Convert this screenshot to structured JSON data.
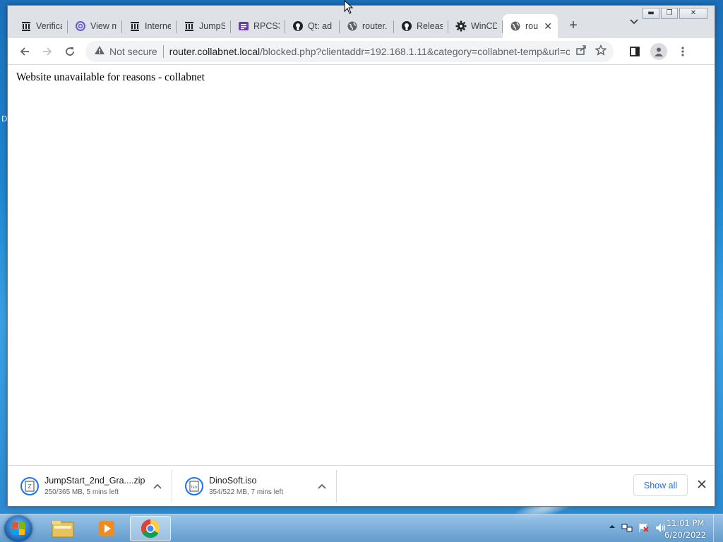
{
  "browser": {
    "tabs": [
      {
        "label": "Verifica",
        "icon": "bank-icon"
      },
      {
        "label": "View m",
        "icon": "at-icon"
      },
      {
        "label": "Interne",
        "icon": "bank-icon"
      },
      {
        "label": "JumpS",
        "icon": "bank-icon"
      },
      {
        "label": "RPCS3",
        "icon": "form-icon"
      },
      {
        "label": "Qt: ad",
        "icon": "github-icon"
      },
      {
        "label": "router.",
        "icon": "globe-icon"
      },
      {
        "label": "Releas",
        "icon": "github-icon"
      },
      {
        "label": "WinCD",
        "icon": "gear-icon"
      },
      {
        "label": "rou",
        "icon": "globe-icon",
        "active": true
      }
    ],
    "omnibox": {
      "security_label": "Not secure",
      "url_host": "router.collabnet.local",
      "url_path": "/blocked.php?clientaddr=192.168.1.11&category=collabnet-temp&url=c..."
    }
  },
  "page": {
    "message": "Website unavailable for reasons - collabnet"
  },
  "downloads": {
    "items": [
      {
        "name": "JumpStart_2nd_Gra....zip",
        "status": "250/365 MB, 5 mins left"
      },
      {
        "name": "DinoSoft.iso",
        "status": "354/522 MB, 7 mins left"
      }
    ],
    "show_all_label": "Show all"
  },
  "taskbar": {
    "time": "11:01 PM",
    "date": "6/20/2022"
  },
  "desktop": {
    "edge_letter": "D"
  }
}
